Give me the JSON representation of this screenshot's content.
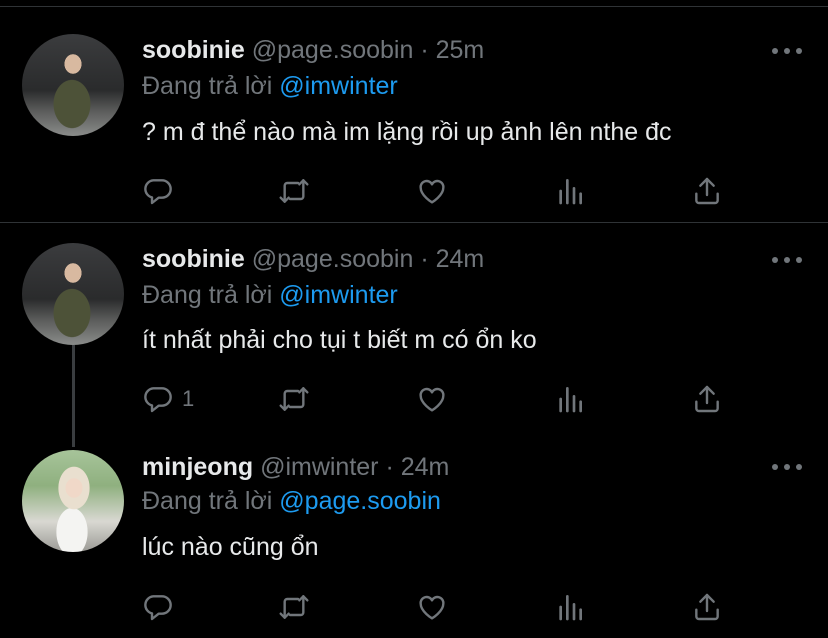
{
  "tweets": [
    {
      "name": "soobinie",
      "handle": "@page.soobin",
      "separator": "·",
      "time": "25m",
      "reply_prefix": "Đang trả lời",
      "reply_to": "@imwinter",
      "text": "? m đ thể nào mà im lặng rồi up ảnh lên nthe đc",
      "reply_count": ""
    },
    {
      "name": "soobinie",
      "handle": "@page.soobin",
      "separator": "·",
      "time": "24m",
      "reply_prefix": "Đang trả lời",
      "reply_to": "@imwinter",
      "text": "ít nhất phải cho tụi t biết m có ổn ko",
      "reply_count": "1"
    },
    {
      "name": "minjeong",
      "handle": "@imwinter",
      "separator": "·",
      "time": "24m",
      "reply_prefix": "Đang trả lời",
      "reply_to": "@page.soobin",
      "text": "lúc nào cũng ổn",
      "reply_count": ""
    }
  ],
  "icons": {
    "reply": "reply-icon",
    "retweet": "retweet-icon",
    "like": "heart-icon",
    "views": "views-icon",
    "share": "share-icon",
    "more": "more-icon"
  },
  "colors": {
    "background": "#000000",
    "text": "#e7e9ea",
    "muted": "#71767b",
    "accent": "#1d9bf0"
  }
}
